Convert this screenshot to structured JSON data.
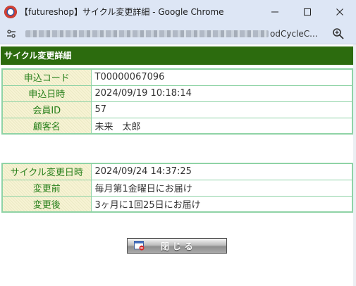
{
  "window": {
    "title": "【futureshop】サイクル変更詳細 - Google Chrome",
    "minimize_glyph": "─",
    "maximize_glyph": "☐",
    "close_glyph": "✕"
  },
  "address": {
    "url_visible": "odCycleC..."
  },
  "header": {
    "title": "サイクル変更詳細"
  },
  "order_info": [
    {
      "label": "申込コード",
      "value": "T00000067096"
    },
    {
      "label": "申込日時",
      "value": "2024/09/19 10:18:14"
    },
    {
      "label": "会員ID",
      "value": "57"
    },
    {
      "label": "顧客名",
      "value": "未来　太郎"
    }
  ],
  "cycle_info": [
    {
      "label": "サイクル変更日時",
      "value": "2024/09/24 14:37:25"
    },
    {
      "label": "変更前",
      "value": "毎月第1金曜日にお届け"
    },
    {
      "label": "変更後",
      "value": "3ヶ月に1回25日にお届け"
    }
  ],
  "close_button": {
    "label": "閉じる"
  },
  "colors": {
    "header_bg": "#2c6b0e",
    "label_text": "#267f1a",
    "table_border": "#8fd3a6",
    "label_bg": "#f7f3d4",
    "titlebar_bg": "#dde6f5"
  }
}
